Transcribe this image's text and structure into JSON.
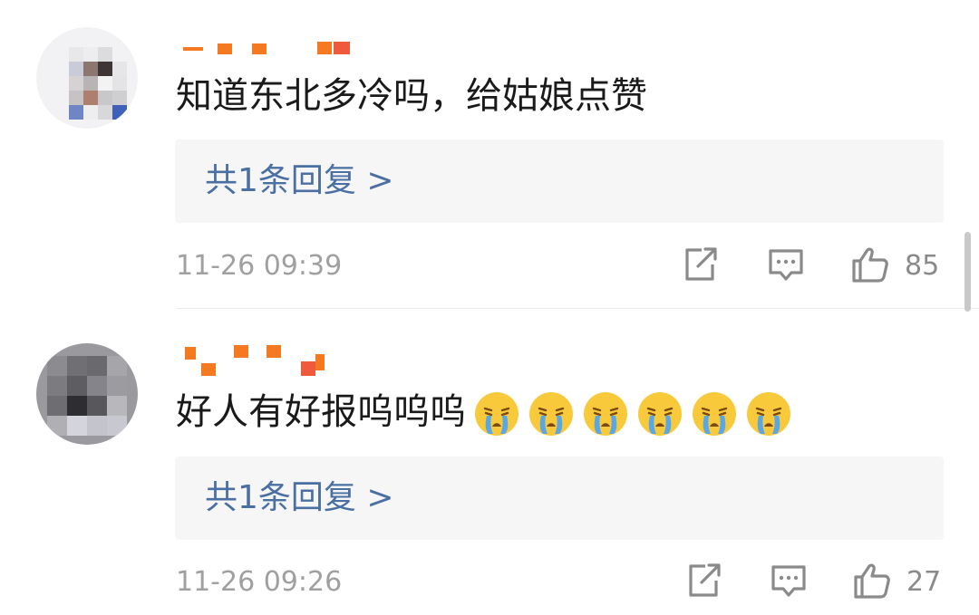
{
  "comments": [
    {
      "text": "知道东北多冷吗，给姑娘点赞",
      "reply_link": "共1条回复 >",
      "timestamp": "11-26 09:39",
      "likes": "85"
    },
    {
      "text": "好人有好报呜呜呜",
      "reply_link": "共1条回复 >",
      "timestamp": "11-26 09:26",
      "likes": "27",
      "emojis": [
        "crying-emoji",
        "crying-emoji",
        "crying-emoji",
        "crying-emoji",
        "crying-emoji",
        "crying-emoji"
      ]
    }
  ],
  "icons": {
    "share": "share-icon",
    "comment": "comment-icon",
    "like": "like-icon"
  },
  "colors": {
    "username": "#f47920",
    "reply_link": "#4a6fa3",
    "meta": "#a0a0a0",
    "reply_bg": "#f6f6f6"
  }
}
